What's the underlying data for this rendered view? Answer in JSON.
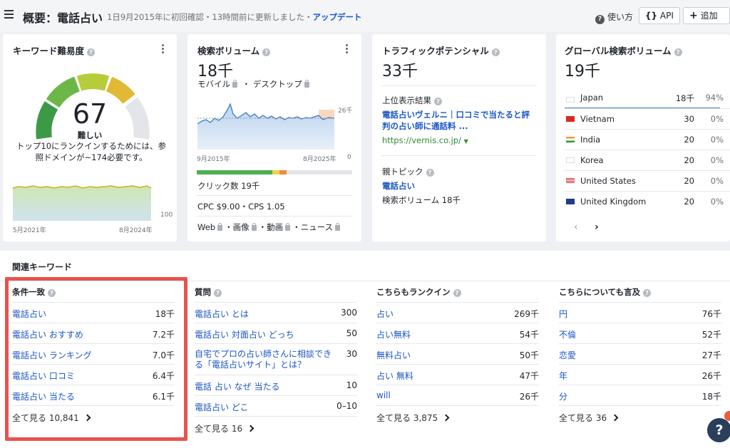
{
  "header": {
    "title": "概要：電話占い",
    "subtitle": "1日9月2015年に初回確認・13時間前に更新しました・",
    "update_link": "アップデート",
    "howto": "使い方",
    "api_label": "API",
    "add_label": "追加"
  },
  "kd": {
    "title": "キーワード難易度",
    "value": "67",
    "difficulty_level": 67,
    "label": "難しい",
    "desc": "トップ10にランクインするためには、参照ドメインが~174必要です。",
    "y_max": "100",
    "y_min": "0",
    "x_start": "5月2021年",
    "x_end": "8月2024年"
  },
  "volume": {
    "title": "検索ボリューム",
    "value": "18千",
    "devices": [
      "モバイル",
      "デスクトップ"
    ],
    "y_max": "26千",
    "y_min": "0",
    "x_start": "9月2015年",
    "x_end": "8月2025年",
    "clicks": "クリック数 19千",
    "cpc": "CPC $9.00・CPS 1.05",
    "serp_types": [
      "Web",
      "画像",
      "動画",
      "ニュース"
    ]
  },
  "traffic": {
    "title": "トラフィックポテンシャル",
    "value": "33千",
    "top_result_label": "上位表示結果",
    "top_result_title": "電話占いヴェルニ｜口コミで当たると評判の占い師に通話料 ...",
    "top_result_url": "https://vernis.co.jp/",
    "parent_topic_label": "親トピック",
    "parent_topic": "電話占い",
    "parent_volume": "検索ボリューム 18千"
  },
  "global": {
    "title": "グローバル検索ボリューム",
    "value": "19千",
    "countries": [
      {
        "name": "Japan",
        "vol": "18千",
        "pct": "94%",
        "flag": "jp"
      },
      {
        "name": "Vietnam",
        "vol": "30",
        "pct": "0%",
        "flag": "vn"
      },
      {
        "name": "India",
        "vol": "20",
        "pct": "0%",
        "flag": "in"
      },
      {
        "name": "Korea",
        "vol": "20",
        "pct": "0%",
        "flag": "kr"
      },
      {
        "name": "United States",
        "vol": "20",
        "pct": "0%",
        "flag": "us"
      },
      {
        "name": "United Kingdom",
        "vol": "20",
        "pct": "0%",
        "flag": "gb"
      }
    ]
  },
  "related": {
    "title": "関連キーワード",
    "columns": [
      {
        "title": "条件一致",
        "rows": [
          {
            "kw": "電話占い",
            "vol": "18千"
          },
          {
            "kw": "電話占い おすすめ",
            "vol": "7.2千"
          },
          {
            "kw": "電話占い ランキング",
            "vol": "7.0千"
          },
          {
            "kw": "電話占い 口コミ",
            "vol": "6.4千"
          },
          {
            "kw": "電話占い 当たる",
            "vol": "6.1千"
          }
        ],
        "see_all": "全て見る 10,841"
      },
      {
        "title": "質問",
        "rows": [
          {
            "kw": "電話占い とは",
            "vol": "300"
          },
          {
            "kw": "電話占い 対面占い どっち",
            "vol": "50"
          },
          {
            "kw": "自宅でプロの占い師さんに相談できる「電話占いサイト」とは？",
            "vol": "30"
          },
          {
            "kw": "電話 占い なぜ 当たる",
            "vol": "10"
          },
          {
            "kw": "電話占い どこ",
            "vol": "0–10"
          }
        ],
        "see_all": "全て見る 16"
      },
      {
        "title": "こちらもランクイン",
        "rows": [
          {
            "kw": "占い",
            "vol": "269千"
          },
          {
            "kw": "占い無料",
            "vol": "54千"
          },
          {
            "kw": "無料占い",
            "vol": "50千"
          },
          {
            "kw": "占い 無料",
            "vol": "47千"
          },
          {
            "kw": "will",
            "vol": "26千"
          }
        ],
        "see_all": "全て見る 3,875"
      },
      {
        "title": "こちらについても言及",
        "rows": [
          {
            "kw": "円",
            "vol": "76千"
          },
          {
            "kw": "不倫",
            "vol": "52千"
          },
          {
            "kw": "恋愛",
            "vol": "27千"
          },
          {
            "kw": "年",
            "vol": "26千"
          },
          {
            "kw": "分",
            "vol": "18千"
          }
        ],
        "see_all": "全て見る 36"
      }
    ]
  },
  "help_fab": "?"
}
